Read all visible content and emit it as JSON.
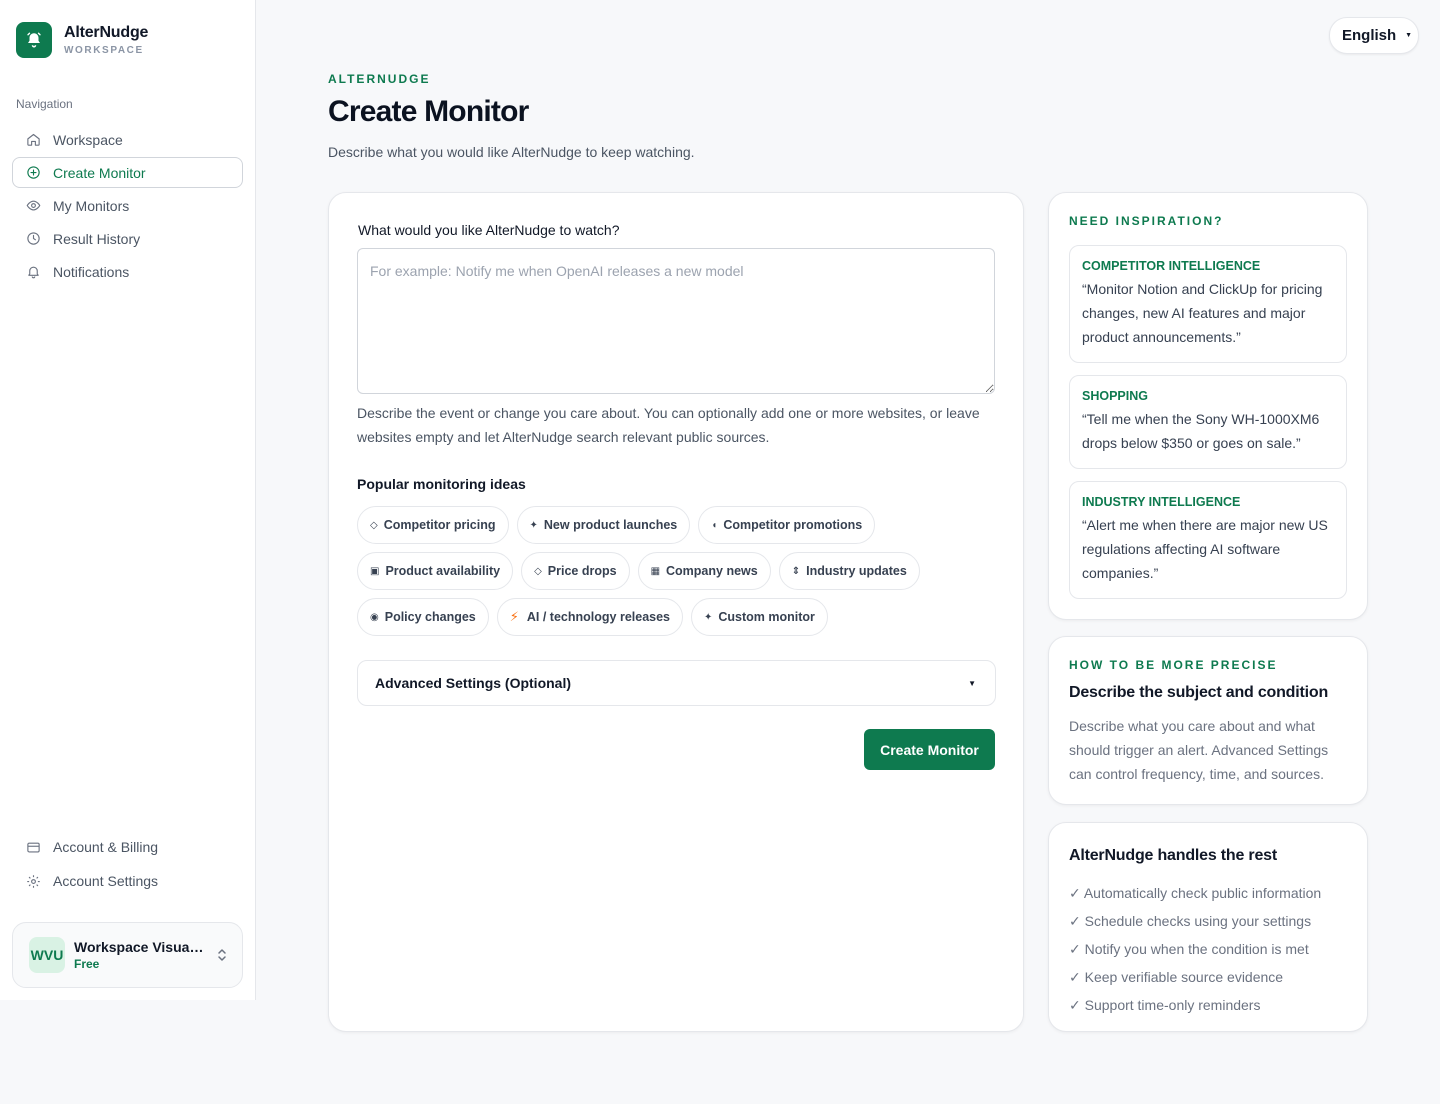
{
  "brand": {
    "name": "AlterNudge",
    "sub": "WORKSPACE"
  },
  "nav": {
    "heading": "Navigation",
    "items": [
      {
        "label": "Workspace",
        "icon": "home-icon"
      },
      {
        "label": "Create Monitor",
        "icon": "plus-circle-icon",
        "active": true
      },
      {
        "label": "My Monitors",
        "icon": "eye-icon"
      },
      {
        "label": "Result History",
        "icon": "clock-icon"
      },
      {
        "label": "Notifications",
        "icon": "bell-icon"
      }
    ],
    "bottom": [
      {
        "label": "Account & Billing",
        "icon": "credit-card-icon"
      },
      {
        "label": "Account Settings",
        "icon": "gear-icon"
      }
    ]
  },
  "workspace": {
    "initials": "WVU",
    "name": "Workspace Visual UI",
    "plan": "Free"
  },
  "language": {
    "label": "English"
  },
  "header": {
    "eyebrow": "ALTERNUDGE",
    "title": "Create Monitor",
    "subtitle": "Describe what you would like AlterNudge to keep watching."
  },
  "form": {
    "label": "What would you like AlterNudge to watch?",
    "placeholder": "For example: Notify me when OpenAI releases a new model",
    "value": "",
    "helper": "Describe the event or change you care about. You can optionally add one or more websites, or leave websites empty and let AlterNudge search relevant public sources.",
    "ideas_title": "Popular monitoring ideas",
    "ideas": [
      {
        "icon": "◇",
        "label": "Competitor pricing"
      },
      {
        "icon": "✦",
        "label": "New product launches"
      },
      {
        "icon": "◖",
        "label": "Competitor promotions"
      },
      {
        "icon": "▣",
        "label": "Product availability"
      },
      {
        "icon": "◇",
        "label": "Price drops"
      },
      {
        "icon": "▦",
        "label": "Company news"
      },
      {
        "icon": "⇕",
        "label": "Industry updates"
      },
      {
        "icon": "◉",
        "label": "Policy changes"
      },
      {
        "icon": "⚡",
        "label": "AI / technology releases"
      },
      {
        "icon": "✦",
        "label": "Custom monitor"
      }
    ],
    "advanced_label": "Advanced Settings (Optional)",
    "submit_label": "Create Monitor"
  },
  "inspiration": {
    "eyebrow": "NEED INSPIRATION?",
    "examples": [
      {
        "category": "COMPETITOR INTELLIGENCE",
        "text": "“Monitor Notion and ClickUp for pricing changes, new AI features and major product announcements.”"
      },
      {
        "category": "SHOPPING",
        "text": "“Tell me when the Sony WH-1000XM6 drops below $350 or goes on sale.”"
      },
      {
        "category": "INDUSTRY INTELLIGENCE",
        "text": "“Alert me when there are major new US regulations affecting AI software companies.”"
      }
    ]
  },
  "precise": {
    "eyebrow": "HOW TO BE MORE PRECISE",
    "heading": "Describe the subject and condition",
    "body": "Describe what you care about and what should trigger an alert. Advanced Settings can control frequency, time, and sources."
  },
  "rest": {
    "heading": "AlterNudge handles the rest",
    "items": [
      "✓ Automatically check public information",
      "✓ Schedule checks using your settings",
      "✓ Notify you when the condition is met",
      "✓ Keep verifiable source evidence",
      "✓ Support time-only reminders"
    ]
  },
  "colors": {
    "brand": "#0e7a4f",
    "background": "#f7f8fa",
    "accent_orange": "#f97316"
  }
}
